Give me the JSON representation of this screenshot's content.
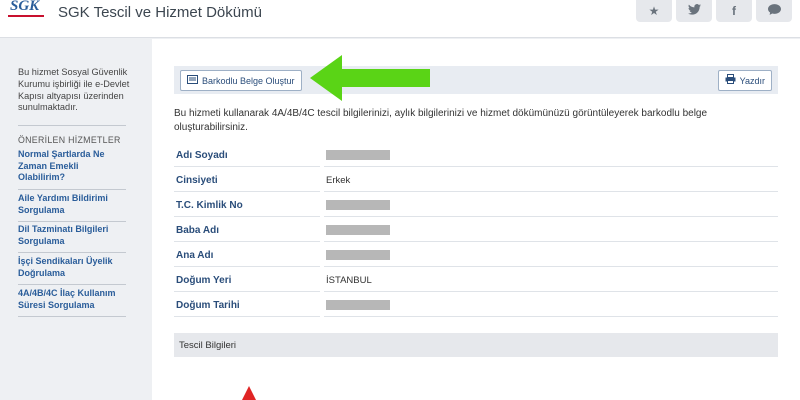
{
  "header": {
    "logo_text": "SGK",
    "title": "SGK Tescil ve Hizmet Dökümü",
    "share_icons": [
      "star-icon",
      "twitter-icon",
      "facebook-icon",
      "comment-icon"
    ]
  },
  "sidebar": {
    "intro": "Bu hizmet Sosyal Güvenlik Kurumu işbirliği ile e-Devlet Kapısı altyapısı üzerinden sunulmaktadır.",
    "recommended_title": "ÖNERİLEN HİZMETLER",
    "services": [
      "Normal Şartlarda Ne Zaman Emekli Olabilirim?",
      "Aile Yardımı Bildirimi Sorgulama",
      "Dil Tazminatı Bilgileri Sorgulama",
      "İşçi Sendikaları Üyelik Doğrulama",
      "4A/4B/4C İlaç Kullanım Süresi Sorgulama"
    ]
  },
  "toolbar": {
    "barcode_label": "Barkodlu Belge Oluştur",
    "print_label": "Yazdır"
  },
  "main": {
    "description": "Bu hizmeti kullanarak 4A/4B/4C tescil bilgilerinizi, aylık bilgilerinizi ve hizmet dökümünüzü görüntüleyerek barkodlu belge oluşturabilirsiniz.",
    "fields": [
      {
        "label": "Adı Soyadı",
        "value": ""
      },
      {
        "label": "Cinsiyeti",
        "value": "Erkek"
      },
      {
        "label": "T.C. Kimlik No",
        "value": ""
      },
      {
        "label": "Baba Adı",
        "value": ""
      },
      {
        "label": "Ana Adı",
        "value": ""
      },
      {
        "label": "Doğum Yeri",
        "value": "İSTANBUL"
      },
      {
        "label": "Doğum Tarihi",
        "value": ""
      }
    ],
    "section_title": "Tescil Bilgileri"
  },
  "colors": {
    "accent": "#2a5d9a",
    "annotation_arrow": "#5ad416",
    "annotation_red": "#e02525"
  }
}
